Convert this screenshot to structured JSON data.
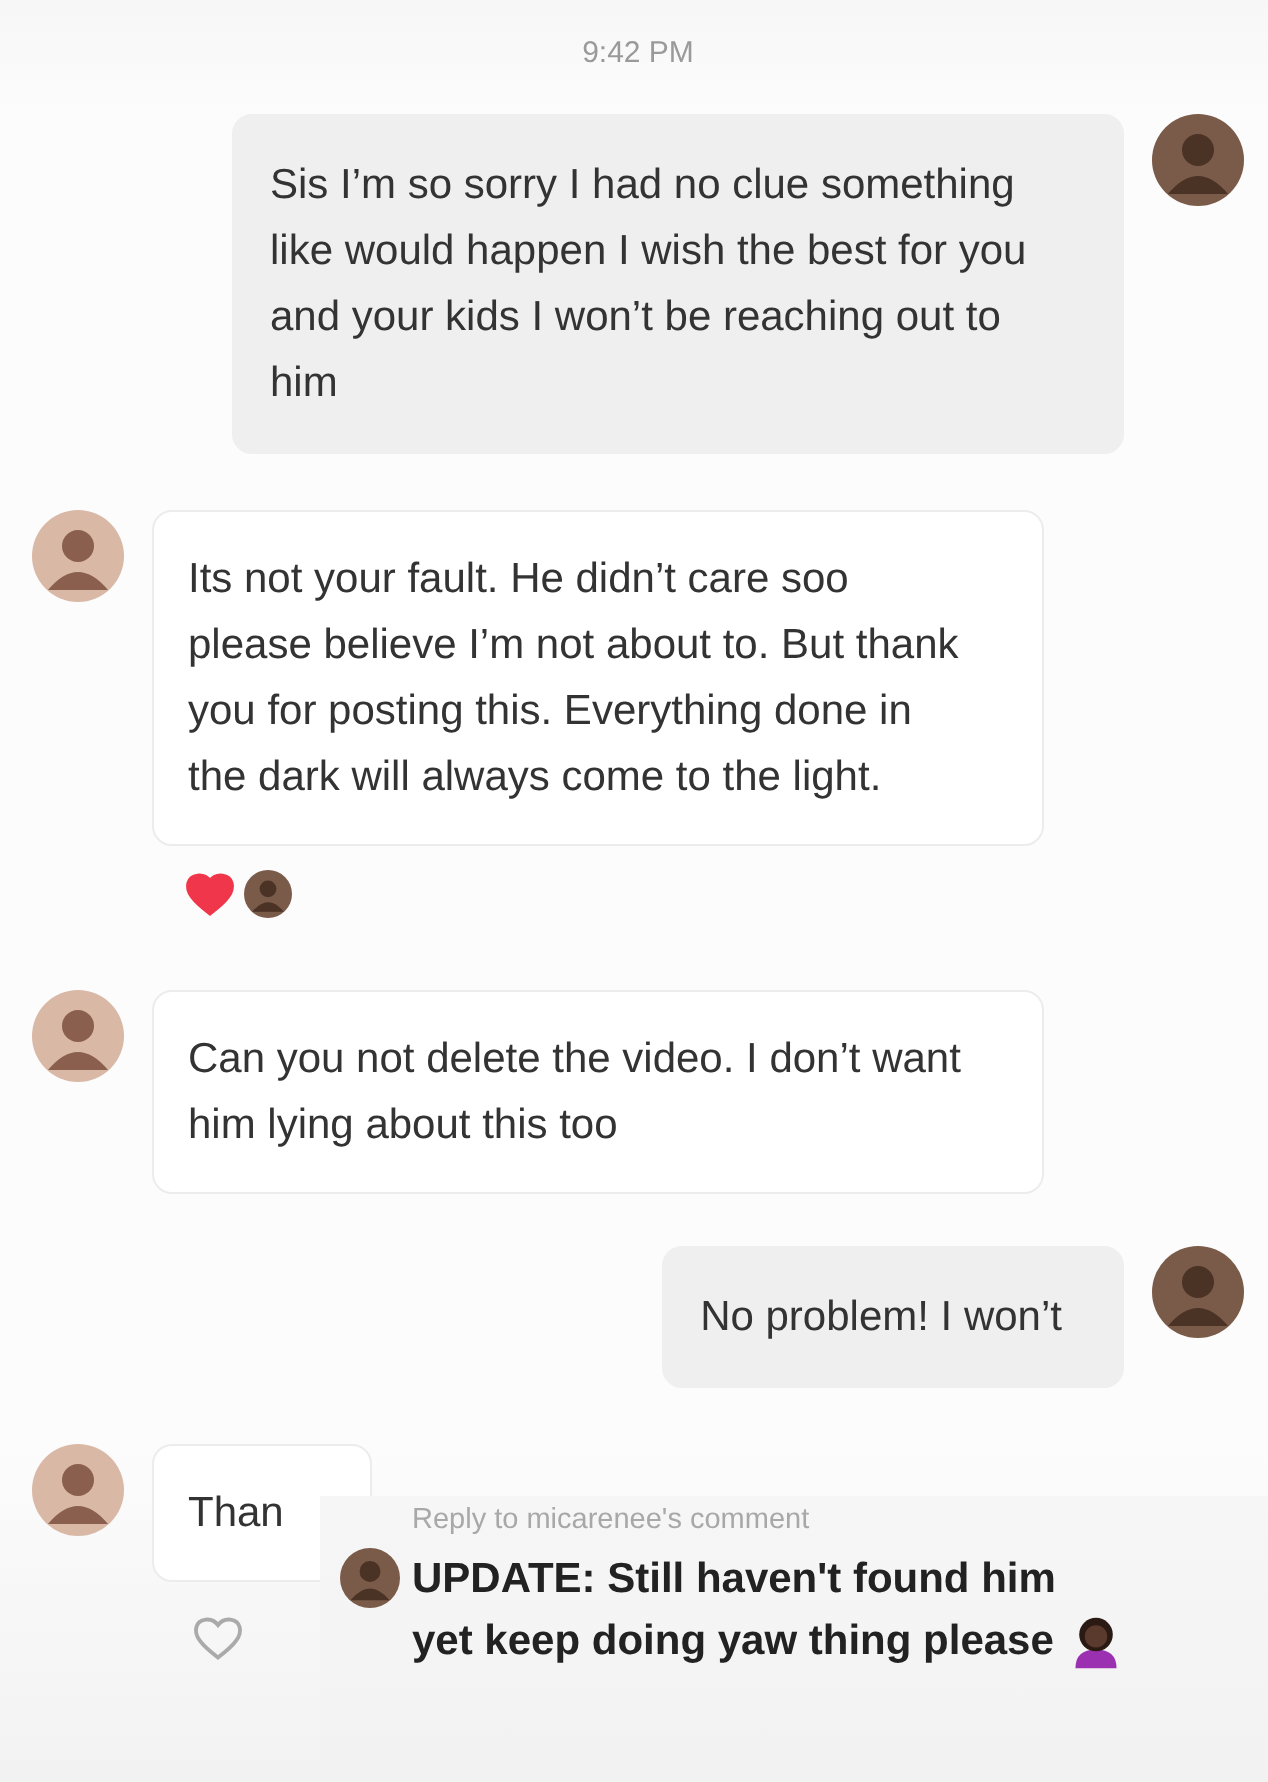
{
  "timestamp": "9:42 PM",
  "messages": [
    {
      "outgoing": true,
      "text": "Sis I’m so sorry I had no clue something like would happen I wish the best for you and your kids I won’t be reaching out to him"
    },
    {
      "outgoing": false,
      "text": "Its not your fault. He didn’t care soo please believe I’m not about to. But thank you for posting this. Everything done in the dark will always come to the light.",
      "reactions": [
        {
          "kind": "heart"
        },
        {
          "kind": "avatar"
        }
      ]
    },
    {
      "outgoing": false,
      "text": "Can you not delete the video. I don’t want him lying about this too"
    },
    {
      "outgoing": true,
      "text": "No problem! I won’t"
    },
    {
      "outgoing": false,
      "text": "Than",
      "liked": false
    }
  ],
  "reply_overlay": {
    "label": "Reply to micarenee's comment",
    "text": "UPDATE: Still haven't found him yet keep doing yaw thing please"
  }
}
